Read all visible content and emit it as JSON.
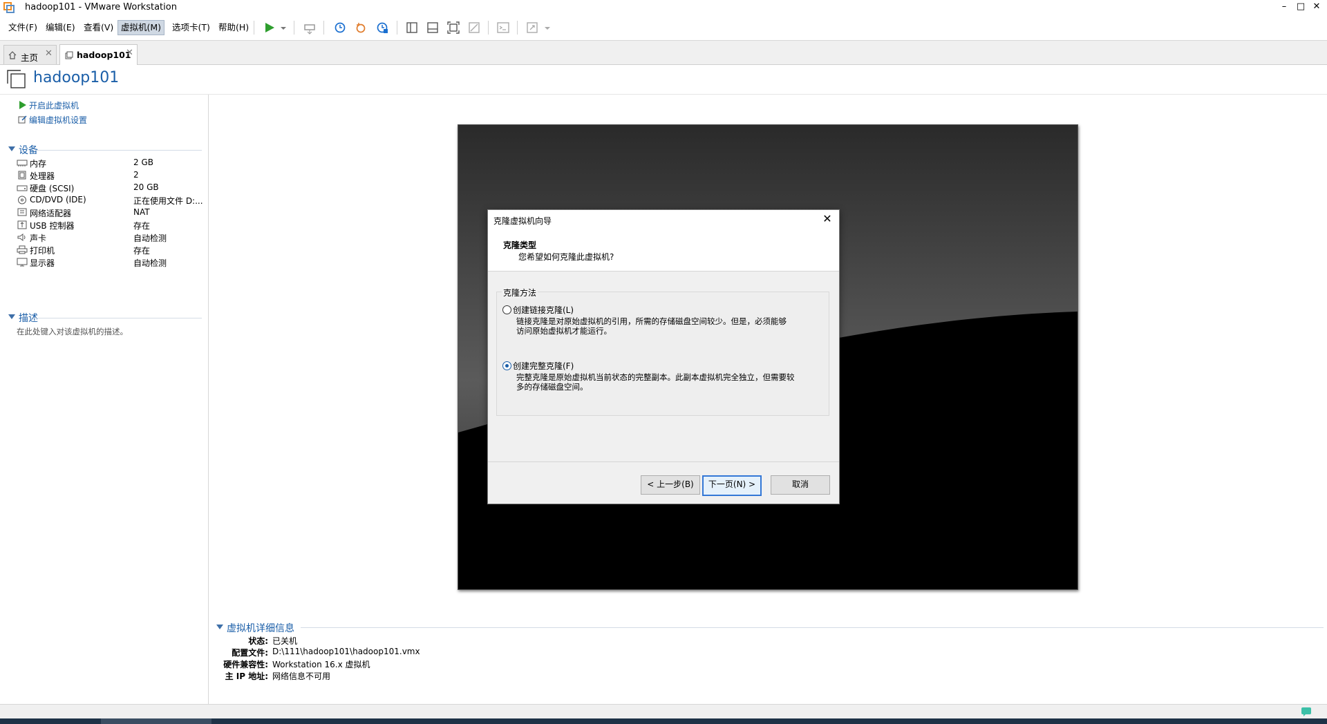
{
  "window": {
    "title": "hadoop101 - VMware Workstation",
    "minimize": "–",
    "maximize": "□",
    "close": "✕"
  },
  "menu": [
    {
      "label": "文件(F)"
    },
    {
      "label": "编辑(E)"
    },
    {
      "label": "查看(V)"
    },
    {
      "label": "虚拟机(M)"
    },
    {
      "label": "选项卡(T)"
    },
    {
      "label": "帮助(H)"
    }
  ],
  "tabs": [
    {
      "label": "主页"
    },
    {
      "label": "hadoop101"
    }
  ],
  "vm": {
    "name": "hadoop101",
    "actions": [
      {
        "label": "开启此虚拟机"
      },
      {
        "label": "编辑虚拟机设置"
      }
    ]
  },
  "devices": {
    "header": "设备",
    "items": [
      {
        "name": "内存",
        "value": "2 GB",
        "icon": "memory-icon"
      },
      {
        "name": "处理器",
        "value": "2",
        "icon": "processor-icon"
      },
      {
        "name": "硬盘 (SCSI)",
        "value": "20 GB",
        "icon": "harddisk-icon"
      },
      {
        "name": "CD/DVD (IDE)",
        "value": "正在使用文件 D:...",
        "icon": "cdrom-icon"
      },
      {
        "name": "网络适配器",
        "value": "NAT",
        "icon": "network-icon"
      },
      {
        "name": "USB 控制器",
        "value": "存在",
        "icon": "usb-icon"
      },
      {
        "name": "声卡",
        "value": "自动检测",
        "icon": "sound-icon"
      },
      {
        "name": "打印机",
        "value": "存在",
        "icon": "printer-icon"
      },
      {
        "name": "显示器",
        "value": "自动检测",
        "icon": "display-icon"
      }
    ]
  },
  "description": {
    "header": "描述",
    "placeholder": "在此处键入对该虚拟机的描述。"
  },
  "dialog": {
    "title": "克隆虚拟机向导",
    "close": "✕",
    "heading": "克隆类型",
    "subheading": "您希望如何克隆此虚拟机?",
    "group_label": "克隆方法",
    "options": [
      {
        "label": "创建链接克隆(L)",
        "checked": false,
        "description": "链接克隆是对原始虚拟机的引用，所需的存储磁盘空间较少。但是，必须能够\n访问原始虚拟机才能运行。"
      },
      {
        "label": "创建完整克隆(F)",
        "checked": true,
        "description": "完整克隆是原始虚拟机当前状态的完整副本。此副本虚拟机完全独立，但需要较\n多的存储磁盘空间。"
      }
    ],
    "buttons": {
      "back": "< 上一步(B)",
      "next": "下一页(N) >",
      "cancel": "取消"
    }
  },
  "details": {
    "header": "虚拟机详细信息",
    "rows": [
      {
        "key": "状态:",
        "value": "已关机"
      },
      {
        "key": "配置文件:",
        "value": "D:\\111\\hadoop101\\hadoop101.vmx"
      },
      {
        "key": "硬件兼容性:",
        "value": "Workstation 16.x 虚拟机"
      },
      {
        "key": "主 IP 地址:",
        "value": "网络信息不可用"
      }
    ]
  },
  "colors": {
    "accent": "#1a5ea8",
    "play": "#2e9e2e",
    "snapshot": "#1a6fd0"
  }
}
